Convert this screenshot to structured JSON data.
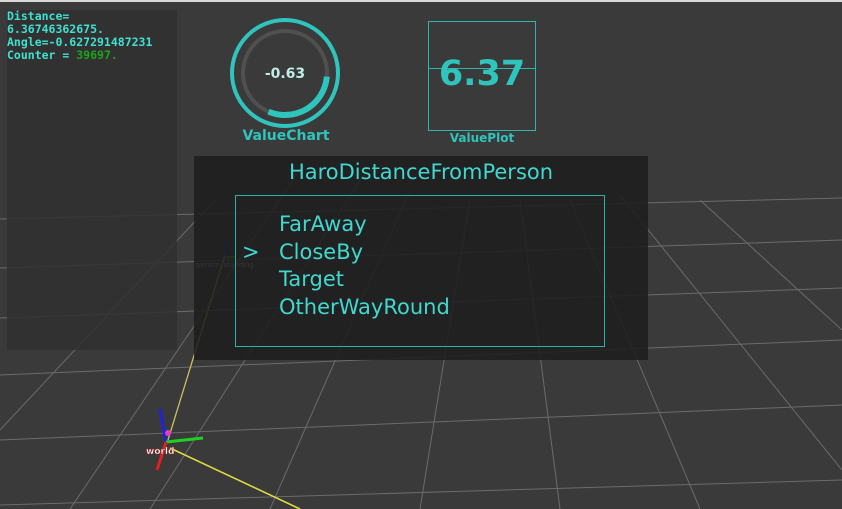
{
  "overlay": {
    "distance_label": "Distance=",
    "distance_value": "6.36746362675.",
    "angle_text": "Angle=-0.627291487231",
    "counter_label": "Counter = ",
    "counter_value": "39697."
  },
  "value_chart": {
    "value": "-0.63",
    "label": "ValueChart",
    "fraction": 0.3
  },
  "value_plot": {
    "value": "6.37",
    "label": "ValuePlot"
  },
  "state_panel": {
    "title": "HaroDistanceFromPerson",
    "cursor": ">",
    "items": [
      "FarAway",
      "CloseBy",
      "Target",
      "OtherWayRound"
    ],
    "selected_index": 1
  },
  "scene": {
    "frame_labels": [
      "person_standing",
      "world"
    ]
  },
  "colors": {
    "accent": "#40d8cf",
    "counter": "#1aa51a",
    "background": "#3a3a3a",
    "grid": "#6a6a6a"
  }
}
